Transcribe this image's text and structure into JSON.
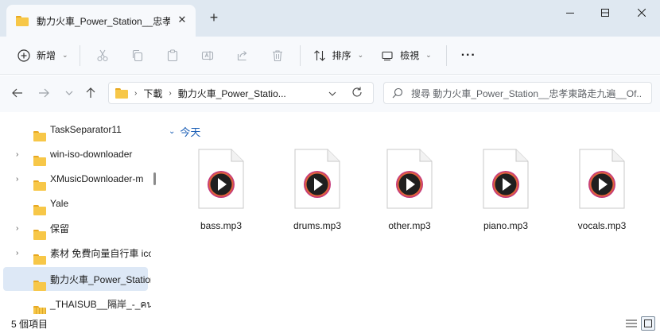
{
  "window": {
    "tab_title": "動力火車_Power_Station__忠孝",
    "tab_close": "✕",
    "new_tab": "+",
    "controls": {
      "minimize": "—",
      "maximize": "☐",
      "close": "✕"
    }
  },
  "toolbar": {
    "new_label": "新增",
    "sort_label": "排序",
    "view_label": "檢視",
    "more_label": "···",
    "icons": [
      "add-icon",
      "cut-icon",
      "copy-icon",
      "paste-icon",
      "rename-icon",
      "share-icon",
      "delete-icon",
      "sort-icon",
      "view-icon",
      "more-icon"
    ]
  },
  "address": {
    "crumbs": [
      "下載",
      "動力火車_Power_Statio..."
    ],
    "chevron": "›",
    "search_placeholder": "搜尋 動力火車_Power_Station__忠孝東路走九遍__Of..."
  },
  "sidebar": {
    "items": [
      {
        "label": "TaskSeparator11",
        "expandable": false,
        "selected": false,
        "zip": false
      },
      {
        "label": "win-iso-downloader",
        "expandable": true,
        "selected": false,
        "zip": false
      },
      {
        "label": "XMusicDownloader-m",
        "expandable": true,
        "selected": false,
        "zip": false
      },
      {
        "label": "Yale",
        "expandable": false,
        "selected": false,
        "zip": false
      },
      {
        "label": "保留",
        "expandable": true,
        "selected": false,
        "zip": false
      },
      {
        "label": "素材 免費向量自行車 ico",
        "expandable": true,
        "selected": false,
        "zip": false
      },
      {
        "label": "動力火車_Power_Station",
        "expandable": false,
        "selected": true,
        "zip": false
      },
      {
        "label": "_THAISUB__隔岸_-_คนสู้",
        "expandable": false,
        "selected": false,
        "zip": true
      }
    ]
  },
  "content": {
    "group_label": "今天",
    "files": [
      {
        "name": "bass.mp3"
      },
      {
        "name": "drums.mp3"
      },
      {
        "name": "other.mp3"
      },
      {
        "name": "piano.mp3"
      },
      {
        "name": "vocals.mp3"
      }
    ]
  },
  "status": {
    "item_count": "5 個項目"
  },
  "colors": {
    "accent": "#1c5fb6",
    "selection": "#dde8f6",
    "title_bg": "#dfe8f1",
    "folder": "#f7c748"
  }
}
